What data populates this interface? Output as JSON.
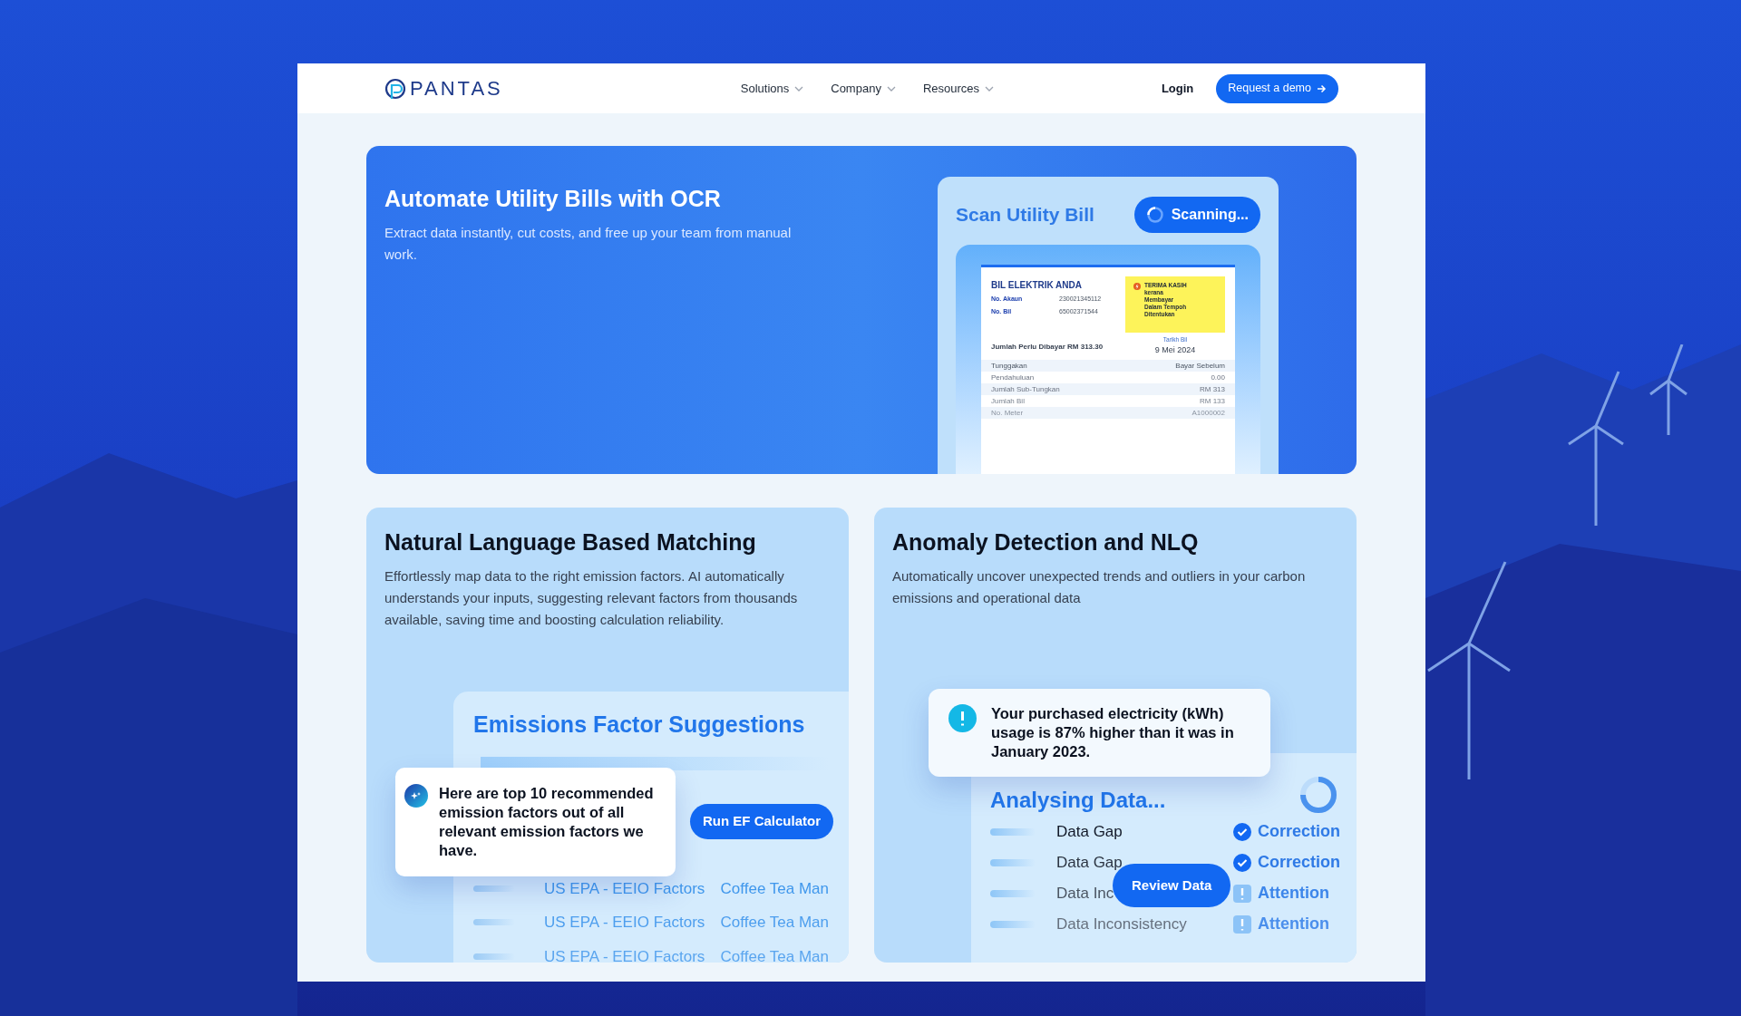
{
  "nav": {
    "logo": "PANTAS",
    "items": [
      {
        "label": "Solutions",
        "has_menu": true
      },
      {
        "label": "Company",
        "has_menu": true
      },
      {
        "label": "Resources",
        "has_menu": true
      }
    ],
    "login": "Login",
    "cta": "Request a demo"
  },
  "ocr": {
    "title": "Automate Utility Bills with OCR",
    "description": "Extract data instantly, cut costs, and free up your team from manual work.",
    "scan": {
      "title": "Scan Utility Bill",
      "status": "Scanning...",
      "bill": {
        "heading": "BIL ELEKTRIK ANDA",
        "fields": [
          {
            "label": "No. Akaun",
            "value": "230021345112"
          },
          {
            "label": "No. Bil",
            "value": "65002371544"
          }
        ],
        "notice": [
          "TERIMA KASIH",
          "kerana",
          "Membayar",
          "Dalam Tempoh",
          "Ditentukan"
        ],
        "amount": "Jumlah Perlu Dibayar RM 313.30",
        "date_label": "Tarikh Bil",
        "date": "9 Mei 2024",
        "rows": [
          {
            "label": "Tunggakan",
            "value": "Bayar Sebelum"
          },
          {
            "label": "Pendahuluan",
            "value": "0.00"
          },
          {
            "label": "Jumlah Sub-Tungkan",
            "value": "RM 313"
          },
          {
            "label": "Jumlah Bil",
            "value": "RM 133"
          },
          {
            "label": "No. Meter",
            "value": "A1000002"
          }
        ]
      }
    }
  },
  "matching": {
    "title": "Natural Language Based Matching",
    "description": "Effortlessly map data to the right emission factors. AI automatically understands your inputs, suggesting relevant factors from thousands available, saving time and boosting calculation reliability.",
    "panel": {
      "title": "Emissions Factor Suggestions",
      "tip": "Here are top 10 recommended emission factors out of all relevant emission factors we have.",
      "button": "Run EF Calculator",
      "rows": [
        {
          "source": "US EPA - EEIO Factors",
          "name": "Coffee Tea Man"
        },
        {
          "source": "US EPA - EEIO Factors",
          "name": "Coffee Tea Man"
        },
        {
          "source": "US EPA - EEIO Factors",
          "name": "Coffee Tea Man"
        }
      ]
    }
  },
  "anomaly": {
    "title": "Anomaly Detection and NLQ",
    "description": "Automatically uncover unexpected trends and outliers in your carbon emissions and operational data",
    "alert": "Your purchased electricity (kWh) usage is 87% higher than it was in January 2023.",
    "panel": {
      "title": "Analysing Data...",
      "button": "Review Data",
      "rows": [
        {
          "label": "Data Gap",
          "status": "Correction",
          "kind": "check"
        },
        {
          "label": "Data Gap",
          "status": "Correction",
          "kind": "check"
        },
        {
          "label": "Data Inc",
          "status": "Attention",
          "kind": "attention"
        },
        {
          "label": "Data Inconsistency",
          "status": "Attention",
          "kind": "attention"
        }
      ]
    }
  }
}
